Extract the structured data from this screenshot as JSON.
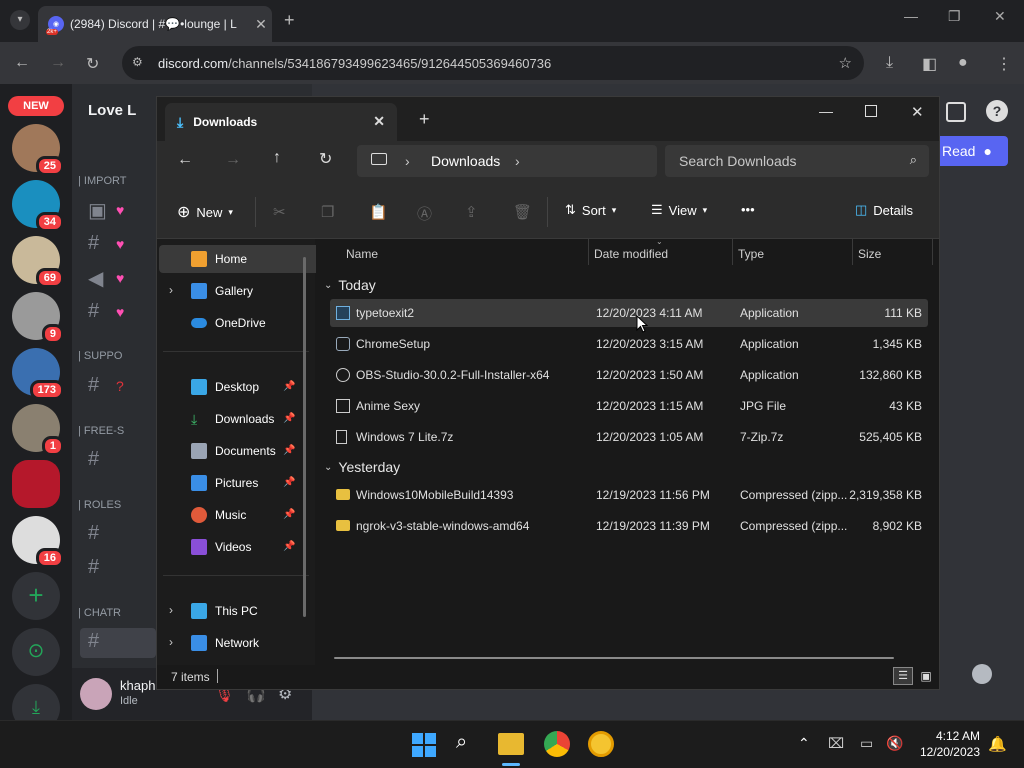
{
  "chrome": {
    "tab_title": "(2984) Discord | #💬•lounge | L",
    "tab_badge": "2k+",
    "url_host": "discord.com",
    "url_path": "/channels/534186793499623465/912644505369460736"
  },
  "discord": {
    "new_badge": "NEW",
    "server_name": "Love L",
    "guild_badges": [
      "25",
      "34",
      "69",
      "9",
      "173",
      "1",
      "16"
    ],
    "categories": [
      "| IMPORT",
      "| SUPPO",
      "| FREE-S",
      "| ROLES",
      "| CHATR"
    ],
    "user_name": "khaph",
    "user_status": "Idle",
    "read_button": "Read"
  },
  "explorer": {
    "tab_title": "Downloads",
    "breadcrumb": "Downloads",
    "search_placeholder": "Search Downloads",
    "toolbar": {
      "new": "New",
      "sort": "Sort",
      "view": "View",
      "more": "•••",
      "details": "Details"
    },
    "nav": [
      {
        "label": "Home"
      },
      {
        "label": "Gallery"
      },
      {
        "label": "OneDrive"
      },
      {
        "label": "Desktop"
      },
      {
        "label": "Downloads"
      },
      {
        "label": "Documents"
      },
      {
        "label": "Pictures"
      },
      {
        "label": "Music"
      },
      {
        "label": "Videos"
      },
      {
        "label": "This PC"
      },
      {
        "label": "Network"
      }
    ],
    "columns": {
      "name": "Name",
      "date": "Date modified",
      "type": "Type",
      "size": "Size"
    },
    "groups": {
      "today": "Today",
      "yesterday": "Yesterday"
    },
    "files": [
      {
        "name": "typetoexit2",
        "date": "12/20/2023 4:11 AM",
        "type": "Application",
        "size": "111 KB"
      },
      {
        "name": "ChromeSetup",
        "date": "12/20/2023 3:15 AM",
        "type": "Application",
        "size": "1,345 KB"
      },
      {
        "name": "OBS-Studio-30.0.2-Full-Installer-x64",
        "date": "12/20/2023 1:50 AM",
        "type": "Application",
        "size": "132,860 KB"
      },
      {
        "name": "Anime Sexy",
        "date": "12/20/2023 1:15 AM",
        "type": "JPG File",
        "size": "43 KB"
      },
      {
        "name": "Windows 7 Lite.7z",
        "date": "12/20/2023 1:05 AM",
        "type": "7-Zip.7z",
        "size": "525,405 KB"
      },
      {
        "name": "Windows10MobileBuild14393",
        "date": "12/19/2023 11:56 PM",
        "type": "Compressed (zipp...",
        "size": "2,319,358 KB"
      },
      {
        "name": "ngrok-v3-stable-windows-amd64",
        "date": "12/19/2023 11:39 PM",
        "type": "Compressed (zipp...",
        "size": "8,902 KB"
      }
    ],
    "status": "7 items"
  },
  "taskbar": {
    "time": "4:12 AM",
    "date": "12/20/2023"
  }
}
